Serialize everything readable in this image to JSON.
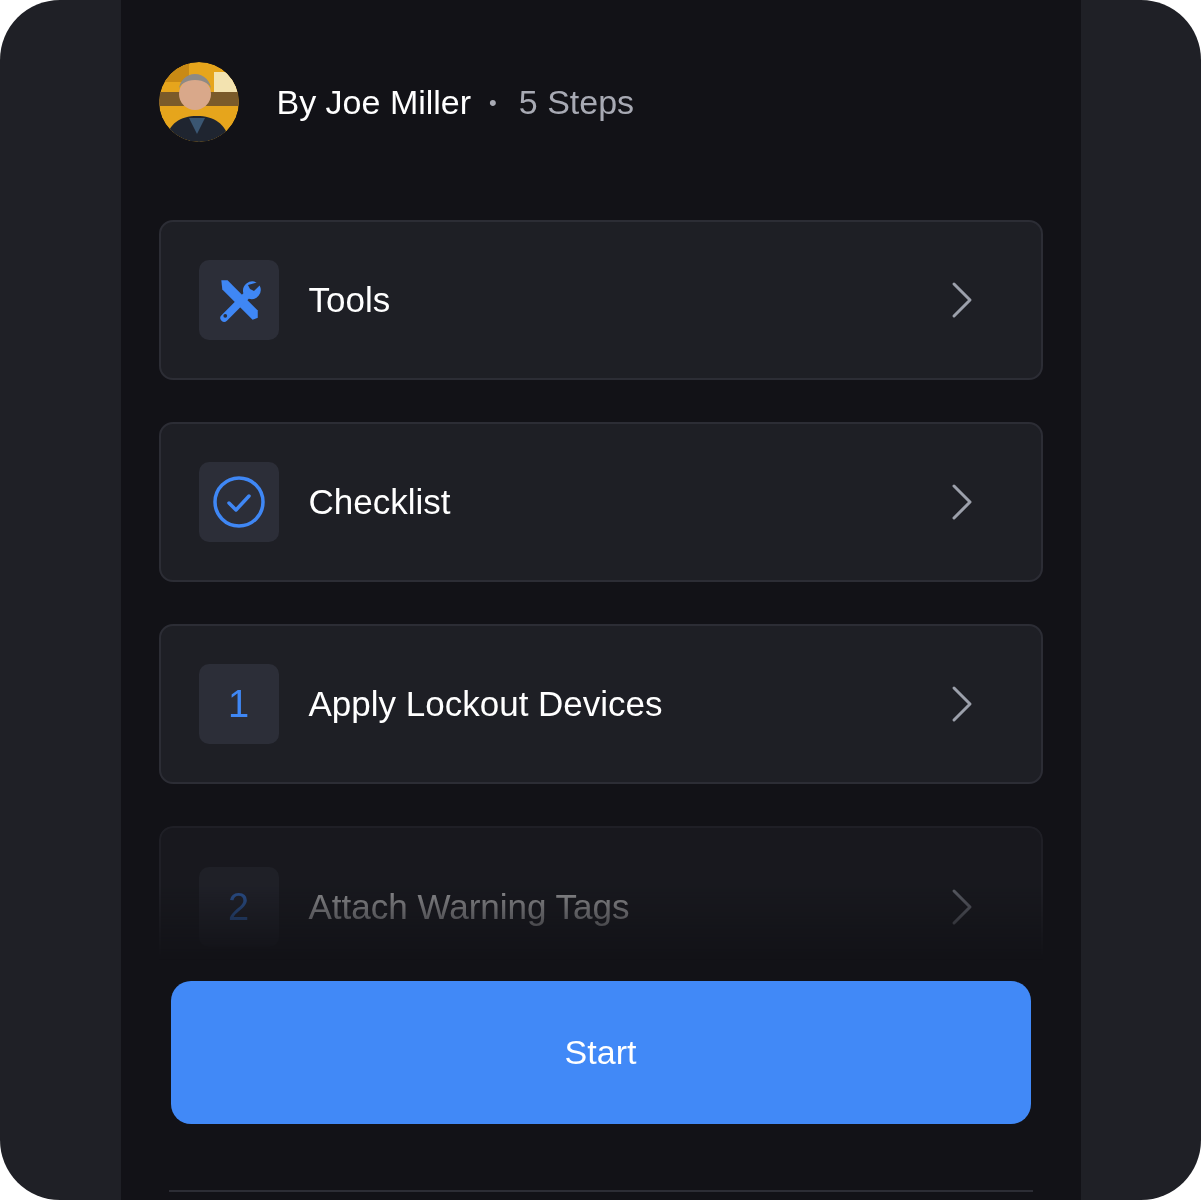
{
  "header": {
    "author": "By Joe Miller",
    "separator": "•",
    "steps": "5 Steps"
  },
  "items": [
    {
      "kind": "tools",
      "label": "Tools",
      "dimmed": false
    },
    {
      "kind": "checklist",
      "label": "Checklist",
      "dimmed": false
    },
    {
      "kind": "step",
      "number": "1",
      "label": "Apply Lockout Devices",
      "dimmed": false
    },
    {
      "kind": "step",
      "number": "2",
      "label": "Attach Warning Tags",
      "dimmed": true
    }
  ],
  "start_button": {
    "label": "Start"
  }
}
